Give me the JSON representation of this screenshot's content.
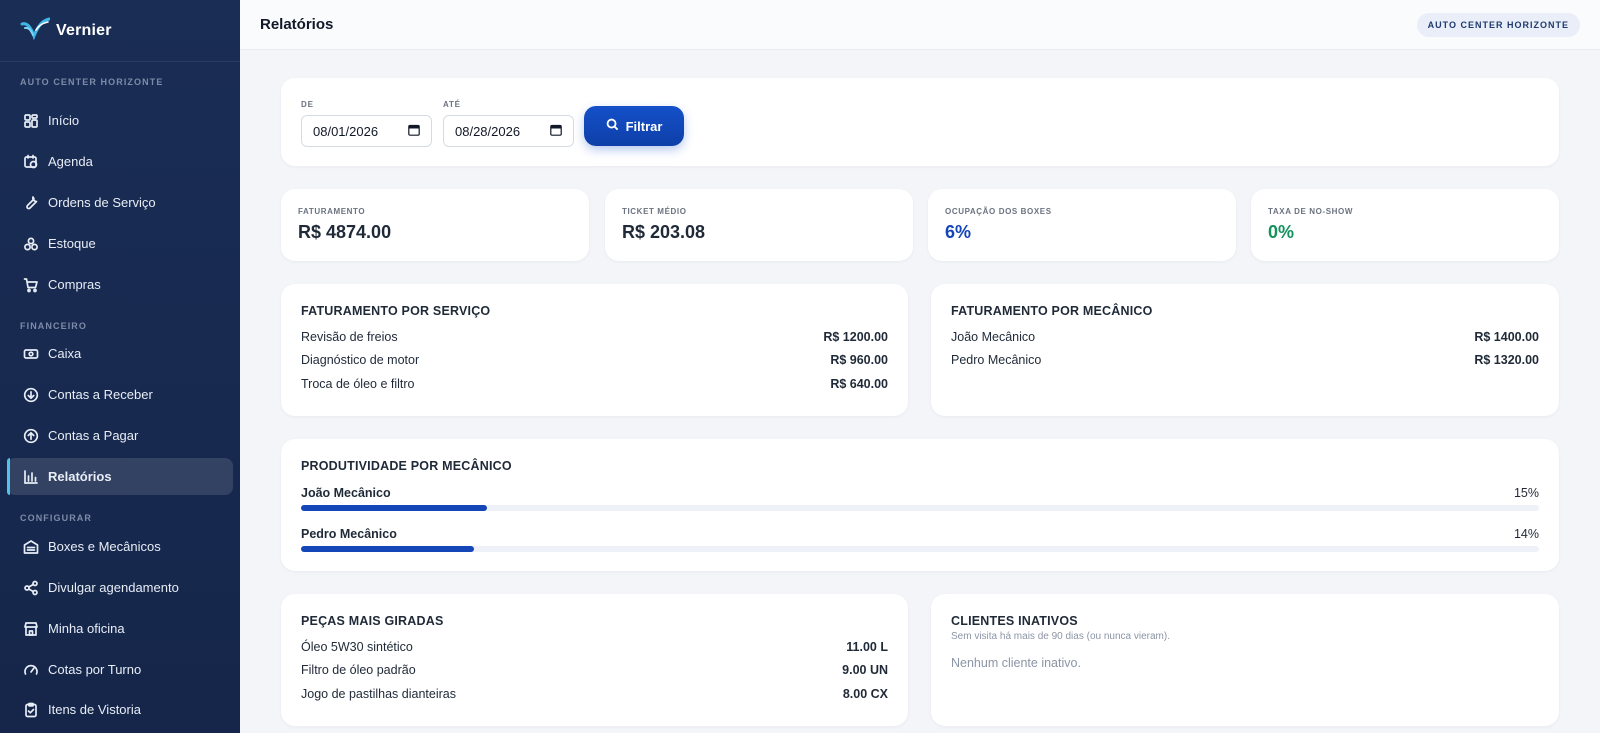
{
  "brand": {
    "name": "Vernier"
  },
  "sidebar": {
    "sections": [
      {
        "label": "AUTO CENTER HORIZONTE"
      },
      {
        "label": "FINANCEIRO"
      },
      {
        "label": "CONFIGURAR"
      }
    ],
    "items": [
      {
        "label": "Início",
        "icon": "grid-icon"
      },
      {
        "label": "Agenda",
        "icon": "calendar-clock-icon"
      },
      {
        "label": "Ordens de Serviço",
        "icon": "wrench-icon"
      },
      {
        "label": "Estoque",
        "icon": "boxes-icon"
      },
      {
        "label": "Compras",
        "icon": "cart-icon"
      },
      {
        "label": "Caixa",
        "icon": "cash-icon"
      },
      {
        "label": "Contas a Receber",
        "icon": "arrow-down-circle-icon"
      },
      {
        "label": "Contas a Pagar",
        "icon": "arrow-up-circle-icon"
      },
      {
        "label": "Relatórios",
        "icon": "bar-chart-icon"
      },
      {
        "label": "Boxes e Mecânicos",
        "icon": "garage-icon"
      },
      {
        "label": "Divulgar agendamento",
        "icon": "share-icon"
      },
      {
        "label": "Minha oficina",
        "icon": "store-icon"
      },
      {
        "label": "Cotas por Turno",
        "icon": "gauge-icon"
      },
      {
        "label": "Itens de Vistoria",
        "icon": "clipboard-check-icon"
      }
    ]
  },
  "header": {
    "title": "Relatórios",
    "tenant": "AUTO CENTER HORIZONTE"
  },
  "filter": {
    "from_label": "DE",
    "from_value": "08/01/2026",
    "to_label": "ATÉ",
    "to_value": "08/28/2026",
    "button_label": "Filtrar"
  },
  "kpis": [
    {
      "label": "FATURAMENTO",
      "value": "R$ 4874.00"
    },
    {
      "label": "TICKET MÉDIO",
      "value": "R$ 203.08"
    },
    {
      "label": "OCUPAÇÃO DOS BOXES",
      "value": "6%"
    },
    {
      "label": "TAXA DE NO-SHOW",
      "value": "0%"
    }
  ],
  "revenue_by_service": {
    "title": "FATURAMENTO POR SERVIÇO",
    "rows": [
      {
        "name": "Revisão de freios",
        "value": "R$ 1200.00"
      },
      {
        "name": "Diagnóstico de motor",
        "value": "R$ 960.00"
      },
      {
        "name": "Troca de óleo e filtro",
        "value": "R$ 640.00"
      }
    ]
  },
  "revenue_by_mechanic": {
    "title": "FATURAMENTO POR MECÂNICO",
    "rows": [
      {
        "name": "João Mecânico",
        "value": "R$ 1400.00"
      },
      {
        "name": "Pedro Mecânico",
        "value": "R$ 1320.00"
      }
    ]
  },
  "productivity": {
    "title": "PRODUTIVIDADE POR MECÂNICO",
    "rows": [
      {
        "name": "João Mecânico",
        "percent_label": "15%",
        "percent": 15
      },
      {
        "name": "Pedro Mecânico",
        "percent_label": "14%",
        "percent": 14
      }
    ]
  },
  "top_parts": {
    "title": "PEÇAS MAIS GIRADAS",
    "rows": [
      {
        "name": "Óleo 5W30 sintético",
        "value": "11.00 L"
      },
      {
        "name": "Filtro de óleo padrão",
        "value": "9.00 UN"
      },
      {
        "name": "Jogo de pastilhas dianteiras",
        "value": "8.00 CX"
      }
    ]
  },
  "inactive_clients": {
    "title": "CLIENTES INATIVOS",
    "subtitle": "Sem visita há mais de 90 dias (ou nunca vieram).",
    "empty": "Nenhum cliente inativo."
  },
  "colors": {
    "sidebar_bg": "#1a2d55",
    "accent_blue": "#1446b8",
    "accent_green": "#14925c",
    "active_marker": "#4fc3e8"
  }
}
